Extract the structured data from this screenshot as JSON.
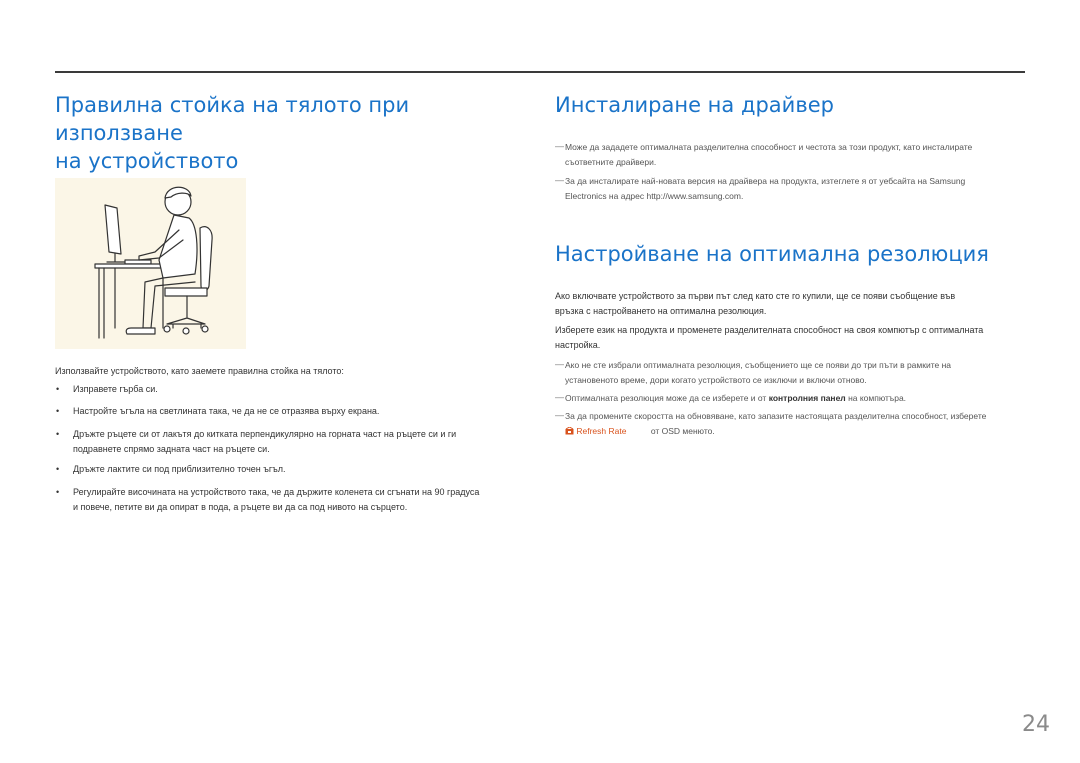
{
  "left": {
    "title_line1": "Правилна стойка на тялото при използване",
    "title_line2": "на устройството",
    "intro": "Използвайте устройството, като заемете правилна стойка на тялото:",
    "bullets": [
      {
        "line1": "Изправете гърба си.",
        "line2": ""
      },
      {
        "line1": "Настройте ъгъла на светлината така, че да не се отразява върху екрана.",
        "line2": ""
      },
      {
        "line1": "Дръжте ръцете си от лакътя до китката перпендикулярно на горната част на ръцете си и ги",
        "line2": "подравнете спрямо задната част на ръцете си."
      },
      {
        "line1": "Дръжте лактите си под приблизително точен ъгъл.",
        "line2": ""
      },
      {
        "line1": "Регулирайте височината на устройството така, че да държите коленета си сгънати на 90 градуса",
        "line2": "и повече, петите ви да опират в пода, а ръцете ви да са под нивото на сърцето."
      }
    ]
  },
  "right": {
    "driver_title": "Инсталиране на драйвер",
    "driver_notes": [
      {
        "line1": "Може да зададете оптималната разделителна способност и честота за този продукт, като инсталирате",
        "line2": "съответните драйвери."
      },
      {
        "line1": "За да инсталирате най-новата версия на драйвера на продукта, изтеглете я от уебсайта на Samsung",
        "line2": "Electronics на адрес http://www.samsung.com."
      }
    ],
    "resolution_title": "Настройване на оптимална резолюция",
    "para1_line1": "Ако включвате устройството за първи път след като сте го купили, ще се появи съобщение във",
    "para1_line2": "връзка с настройването на оптимална резолюция.",
    "para2_line1": "Изберете език на продукта и променете разделителната способност на своя компютър с оптималната",
    "para2_line2": "настройка.",
    "notes": {
      "n1_line1": "Ако не сте избрали оптималната резолюция, съобщението ще се появи до три пъти в рамките на",
      "n1_line2": "установеното време, дори когато устройството се изключи и включи отново.",
      "n2_pre": "Оптималната резолюция може да се изберете и от ",
      "n2_hl": "контролния панел",
      "n2_post": " на компютъра.",
      "n3_line1": "За да промените скоростта на обновяване, като запазите настоящата разделителна способност, изберете",
      "n3_menu": "Refresh Rate",
      "n3_post": "от OSD менюто."
    }
  },
  "page_number": "24",
  "colors": {
    "heading": "#1a73c8",
    "accent": "#d9531e",
    "illustration_bg": "#fbf6e7"
  }
}
